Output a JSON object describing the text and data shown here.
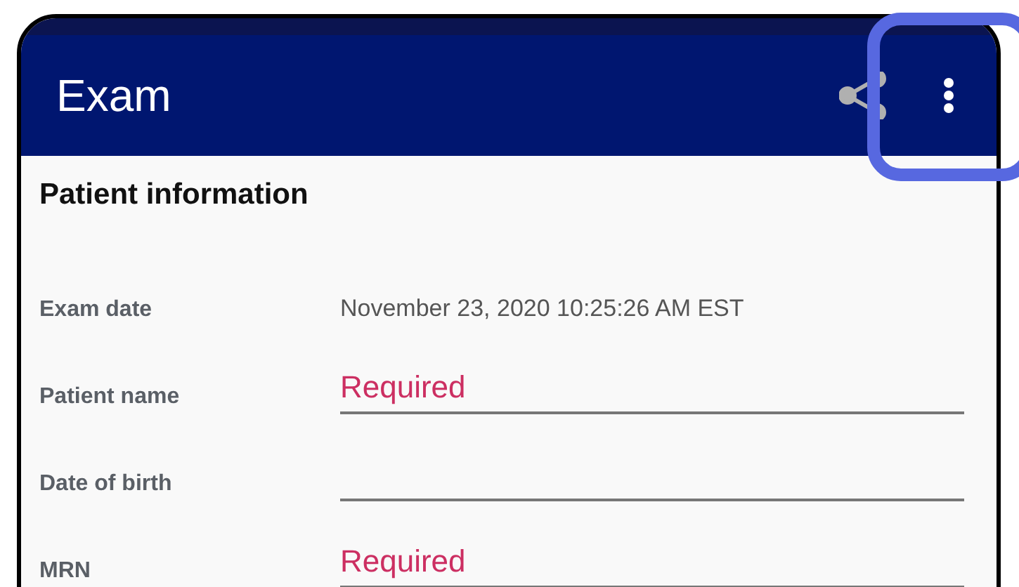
{
  "app_bar": {
    "title": "Exam"
  },
  "section": {
    "title": "Patient information"
  },
  "fields": [
    {
      "label": "Exam date",
      "kind": "text",
      "value": "November 23, 2020 10:25:26 AM EST"
    },
    {
      "label": "Patient name",
      "kind": "input",
      "placeholder": "Required"
    },
    {
      "label": "Date of birth",
      "kind": "input"
    },
    {
      "label": "MRN",
      "kind": "input",
      "placeholder": "Required"
    }
  ]
}
